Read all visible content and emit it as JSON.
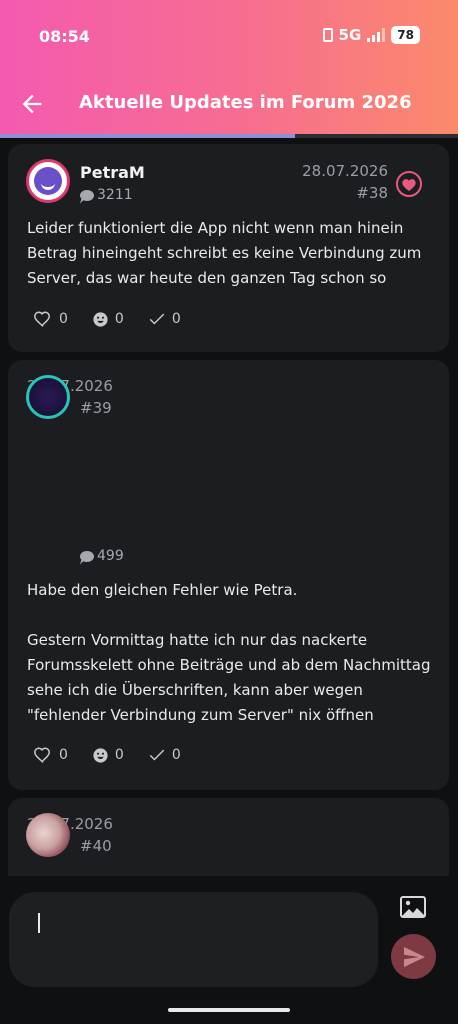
{
  "status": {
    "time": "08:54",
    "network": "5G",
    "battery": "78"
  },
  "header": {
    "title": "Aktuelle Updates im Forum 2026"
  },
  "progress": {
    "value": 0.645
  },
  "posts": [
    {
      "author": "PetraM",
      "comments": "3211",
      "date": "28.07.2026",
      "number": "#38",
      "text": "Leider funktioniert die App nicht wenn man hinein Betrag hineingeht schreibt es keine Verbindung zum Server, das war heute den ganzen Tag schon so",
      "likes": "0",
      "smiles": "0",
      "checks": "0"
    },
    {
      "author": "",
      "comments": "499",
      "date": "29.07.2026",
      "number": "#39",
      "text_1": "Habe den gleichen Fehler wie Petra.",
      "text_2": "Gestern Vormittag hatte ich nur das nackerte Forumsskelett ohne Beiträge und ab dem Nachmittag sehe ich die Überschriften, kann aber wegen \"fehlender Verbindung zum Server\" nix öffnen",
      "likes": "0",
      "smiles": "0",
      "checks": "0"
    },
    {
      "author": "",
      "date": "29.07.2026",
      "number": "#40"
    }
  ],
  "composer": {
    "value": ""
  },
  "colors": {
    "accent": "#f45ab0",
    "accent_end": "#fb8a6b",
    "card": "#1c1d21",
    "background": "#0f1012",
    "send": "#7d3a42"
  },
  "icons": [
    "back-arrow-icon",
    "heart-outline-icon",
    "smile-icon",
    "check-icon",
    "chat-bubble-icon",
    "favorite-heart-icon",
    "image-icon",
    "send-icon"
  ]
}
